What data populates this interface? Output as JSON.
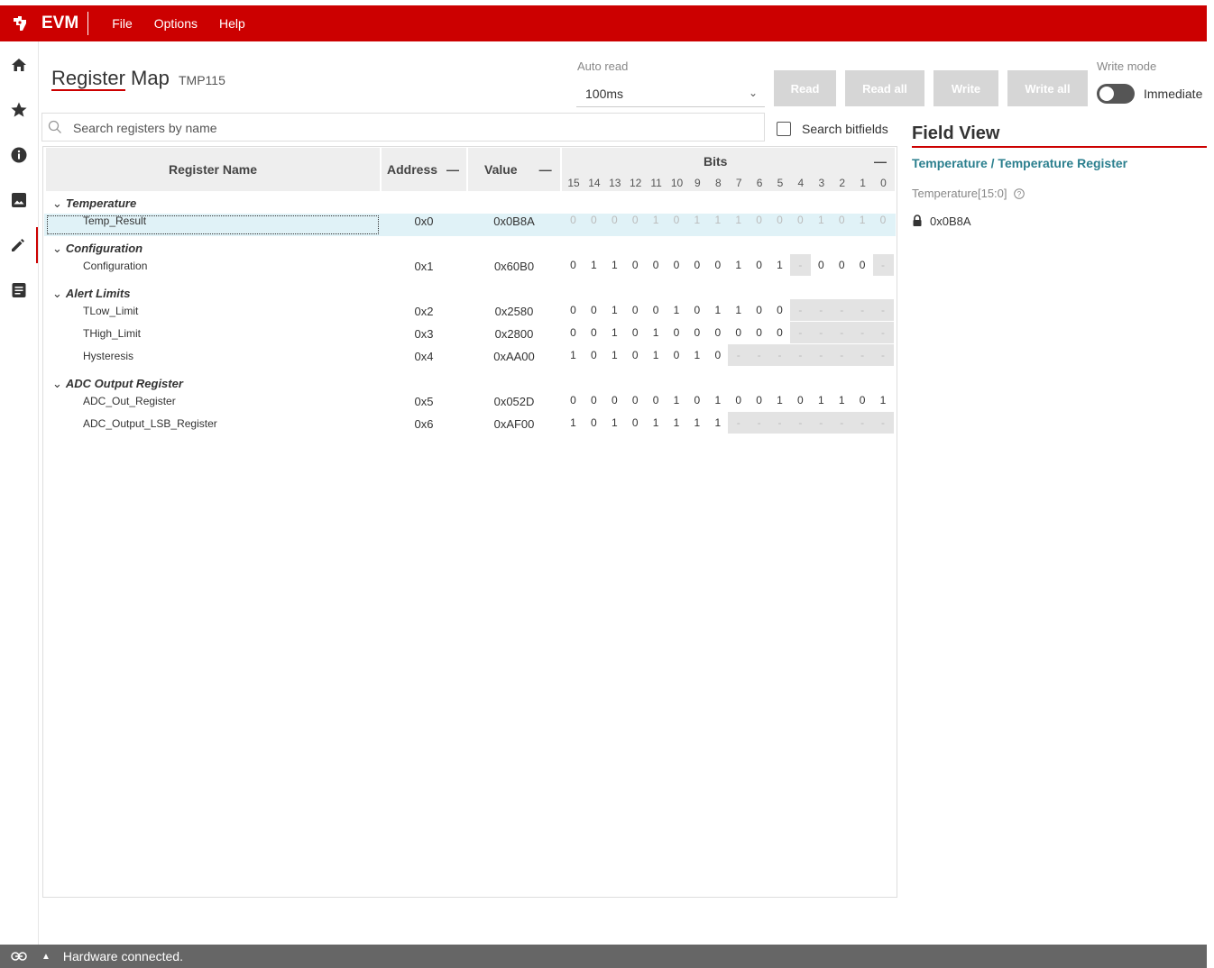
{
  "app": {
    "name": "EVM",
    "brand_color": "#cc0000"
  },
  "menu": [
    "File",
    "Options",
    "Help"
  ],
  "nav_icons": [
    "home-icon",
    "star-icon",
    "info-icon",
    "image-icon",
    "pencil-icon",
    "document-icon"
  ],
  "header": {
    "title": "Register Map",
    "subtitle": "TMP115"
  },
  "auto_read": {
    "label": "Auto read",
    "value": "100ms"
  },
  "buttons": {
    "read": "Read",
    "read_all": "Read all",
    "write": "Write",
    "write_all": "Write all"
  },
  "write_mode": {
    "label": "Write mode",
    "toggle_label": "Immediate"
  },
  "search": {
    "placeholder": "Search registers by name",
    "bitfields_label": "Search bitfields"
  },
  "table": {
    "headers": {
      "name": "Register Name",
      "address": "Address",
      "value": "Value",
      "bits": "Bits"
    },
    "bit_numbers": [
      "15",
      "14",
      "13",
      "12",
      "11",
      "10",
      "9",
      "8",
      "7",
      "6",
      "5",
      "4",
      "3",
      "2",
      "1",
      "0"
    ],
    "groups": [
      {
        "label": "Temperature",
        "rows": [
          {
            "name": "Temp_Result",
            "address": "0x0",
            "value": "0x0B8A",
            "bits": [
              "0",
              "0",
              "0",
              "0",
              "1",
              "0",
              "1",
              "1",
              "1",
              "0",
              "0",
              "0",
              "1",
              "0",
              "1",
              "0"
            ],
            "selected": true
          }
        ]
      },
      {
        "label": "Configuration",
        "rows": [
          {
            "name": "Configuration",
            "address": "0x1",
            "value": "0x60B0",
            "bits": [
              "0",
              "1",
              "1",
              "0",
              "0",
              "0",
              "0",
              "0",
              "1",
              "0",
              "1",
              "-",
              "0",
              "0",
              "0",
              "-"
            ]
          }
        ]
      },
      {
        "label": "Alert Limits",
        "rows": [
          {
            "name": "TLow_Limit",
            "address": "0x2",
            "value": "0x2580",
            "bits": [
              "0",
              "0",
              "1",
              "0",
              "0",
              "1",
              "0",
              "1",
              "1",
              "0",
              "0",
              "-",
              "-",
              "-",
              "-",
              "-"
            ]
          },
          {
            "name": "THigh_Limit",
            "address": "0x3",
            "value": "0x2800",
            "bits": [
              "0",
              "0",
              "1",
              "0",
              "1",
              "0",
              "0",
              "0",
              "0",
              "0",
              "0",
              "-",
              "-",
              "-",
              "-",
              "-"
            ]
          },
          {
            "name": "Hysteresis",
            "address": "0x4",
            "value": "0xAA00",
            "bits": [
              "1",
              "0",
              "1",
              "0",
              "1",
              "0",
              "1",
              "0",
              "-",
              "-",
              "-",
              "-",
              "-",
              "-",
              "-",
              "-"
            ]
          }
        ]
      },
      {
        "label": "ADC Output Register",
        "rows": [
          {
            "name": "ADC_Out_Register",
            "address": "0x5",
            "value": "0x052D",
            "bits": [
              "0",
              "0",
              "0",
              "0",
              "0",
              "1",
              "0",
              "1",
              "0",
              "0",
              "1",
              "0",
              "1",
              "1",
              "0",
              "1"
            ]
          },
          {
            "name": "ADC_Output_LSB_Register",
            "address": "0x6",
            "value": "0xAF00",
            "bits": [
              "1",
              "0",
              "1",
              "0",
              "1",
              "1",
              "1",
              "1",
              "-",
              "-",
              "-",
              "-",
              "-",
              "-",
              "-",
              "-"
            ]
          }
        ]
      }
    ]
  },
  "field_view": {
    "title": "Field View",
    "path": "Temperature / Temperature Register",
    "field": "Temperature[15:0]",
    "value": "0x0B8A"
  },
  "status": {
    "text": "Hardware connected."
  }
}
